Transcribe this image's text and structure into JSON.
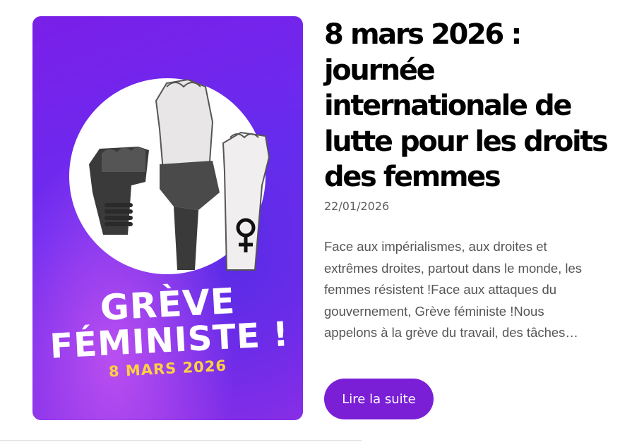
{
  "article": {
    "image": {
      "poster_line1": "GRÈVE",
      "poster_line2": "FÉMINISTE !",
      "poster_date": "8 MARS 2026",
      "colors": {
        "background": "#7a1fe8",
        "accent": "#ffd23f"
      }
    },
    "title": "8 mars 2026 : journée internationale de lutte pour les droits des femmes",
    "date": "22/01/2026",
    "excerpt": "Face aux impérialismes, aux droites et extrêmes droites, partout dans le monde, les femmes résistent !Face aux attaques du gouvernement, Grève féministe !Nous appelons à la grève du travail, des tâches…",
    "button_label": "Lire la suite",
    "colors": {
      "button": "#7a1fd6",
      "title": "#000000",
      "text": "#555555"
    }
  }
}
